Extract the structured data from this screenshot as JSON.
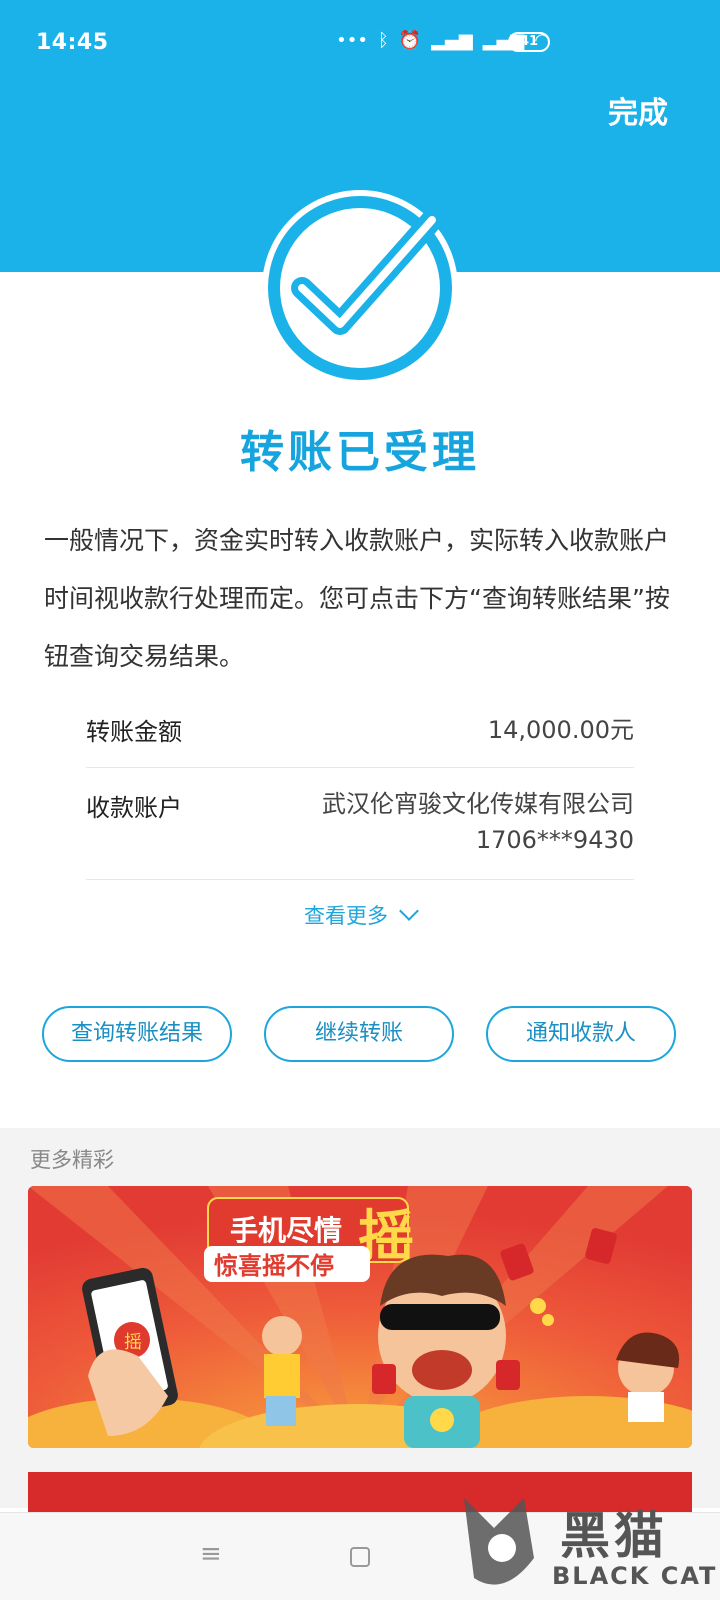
{
  "status_bar": {
    "time": "14:45",
    "icons": [
      "more-dots-icon",
      "bluetooth-icon",
      "alarm-icon",
      "signal-hd-icon",
      "signal-hd-icon",
      "wifi-icon"
    ],
    "battery": "41"
  },
  "header": {
    "done_label": "完成"
  },
  "result": {
    "title": "转账已受理",
    "description": "一般情况下，资金实时转入收款账户，实际转入收款账户时间视收款行处理而定。您可点击下方“查询转账结果”按钮查询交易结果。"
  },
  "details": {
    "amount_label": "转账金额",
    "amount_value": "14,000.00元",
    "account_label": "收款账户",
    "account_name": "武汉伦宵骏文化传媒有限公司",
    "account_number": "1706***9430"
  },
  "see_more": "查看更多",
  "actions": {
    "query": "查询转账结果",
    "continue": "继续转账",
    "notify": "通知收款人"
  },
  "more": {
    "title": "更多精彩",
    "banner1": {
      "line1": "手机尽情",
      "big": "摇",
      "line2": "惊喜摇不停",
      "phone_char": "摇"
    }
  },
  "watermark": {
    "cn": "黑猫",
    "en": "BLACK CAT"
  },
  "colors": {
    "accent": "#1ab2e8",
    "banner_red": "#e8453a"
  }
}
